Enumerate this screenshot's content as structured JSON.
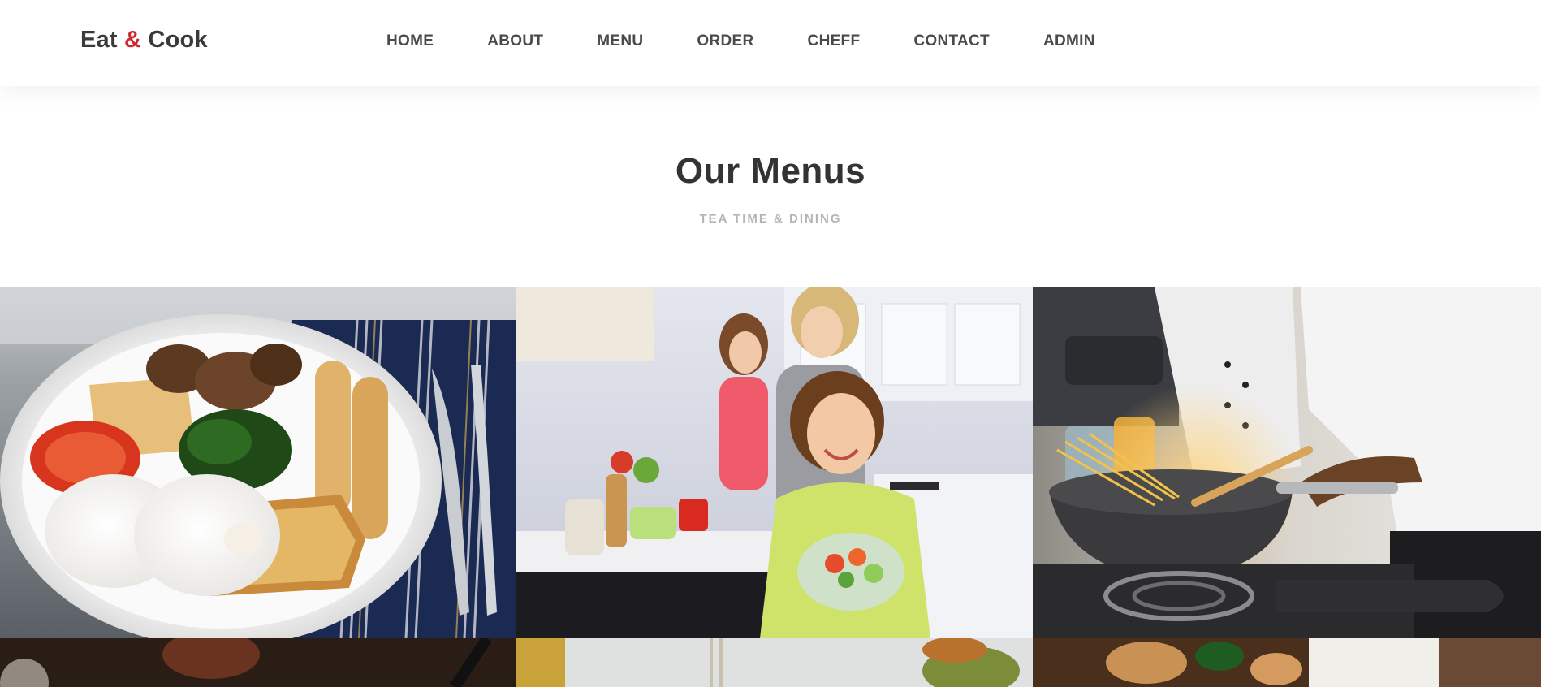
{
  "header": {
    "logo": {
      "part1": "Eat",
      "amp": "&",
      "part2": "Cook"
    },
    "nav": [
      {
        "label": "HOME"
      },
      {
        "label": "ABOUT"
      },
      {
        "label": "MENU"
      },
      {
        "label": "ORDER"
      },
      {
        "label": "CHEFF"
      },
      {
        "label": "CONTACT"
      },
      {
        "label": "ADMIN"
      }
    ]
  },
  "menus": {
    "title": "Our Menus",
    "subtitle": "TEA TIME & DINING"
  },
  "colors": {
    "accent": "#d0282f",
    "nav_text": "#4a4a4a",
    "subtitle_text": "#b5b5b5"
  }
}
